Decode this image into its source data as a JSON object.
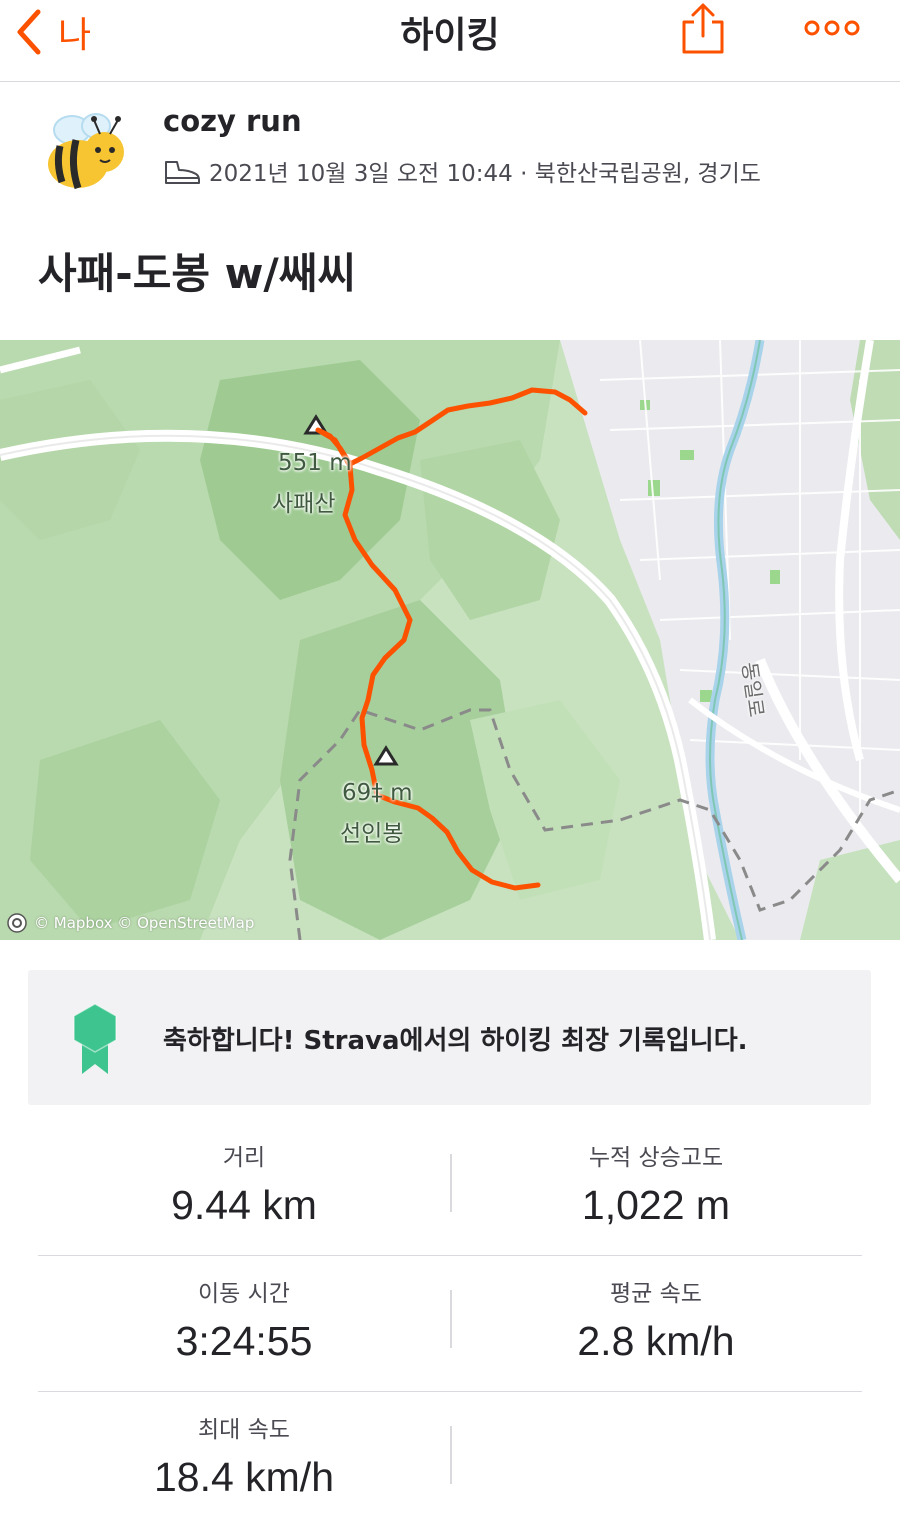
{
  "header": {
    "back_label": "나",
    "title": "하이킹",
    "icons": {
      "back": "chevron-left-icon",
      "share": "share-icon",
      "more": "more-icon"
    },
    "accent_color": "#fc5200"
  },
  "athlete": {
    "name": "cozy run",
    "avatar": "bee-avatar",
    "activity_icon": "shoe-icon",
    "meta": "2021년 10월 3일 오전 10:44 · 북한산국립공원, 경기도"
  },
  "activity": {
    "title": "사패-도봉 w/쌔씨"
  },
  "map": {
    "peaks": [
      {
        "elevation": "551 m",
        "name": "사패산"
      },
      {
        "elevation": "69‡ m",
        "name": "선인봉"
      }
    ],
    "road_label": "동일로",
    "attribution": "© Mapbox © OpenStreetMap",
    "route_color": "#fc5200"
  },
  "achievement": {
    "icon": "medal-icon",
    "text": "축하합니다! Strava에서의 하이킹 최장 기록입니다.",
    "medal_color": "#3ec48e"
  },
  "stats": [
    {
      "label": "거리",
      "value": "9.44 km"
    },
    {
      "label": "누적 상승고도",
      "value": "1,022 m"
    },
    {
      "label": "이동 시간",
      "value": "3:24:55"
    },
    {
      "label": "평균 속도",
      "value": "2.8 km/h"
    },
    {
      "label": "최대 속도",
      "value": "18.4 km/h"
    }
  ]
}
